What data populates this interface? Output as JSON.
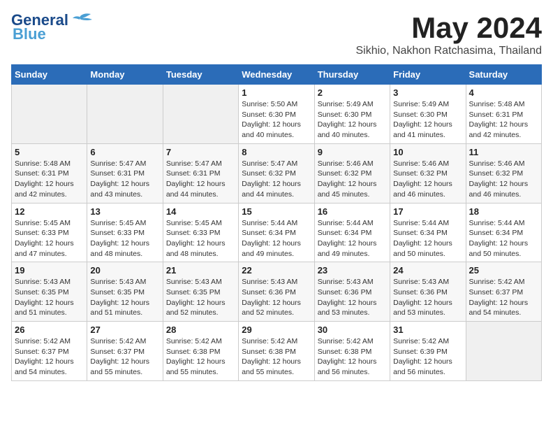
{
  "header": {
    "logo_line1": "General",
    "logo_line2": "Blue",
    "month": "May 2024",
    "location": "Sikhio, Nakhon Ratchasima, Thailand"
  },
  "weekdays": [
    "Sunday",
    "Monday",
    "Tuesday",
    "Wednesday",
    "Thursday",
    "Friday",
    "Saturday"
  ],
  "weeks": [
    [
      {
        "day": "",
        "info": ""
      },
      {
        "day": "",
        "info": ""
      },
      {
        "day": "",
        "info": ""
      },
      {
        "day": "1",
        "info": "Sunrise: 5:50 AM\nSunset: 6:30 PM\nDaylight: 12 hours\nand 40 minutes."
      },
      {
        "day": "2",
        "info": "Sunrise: 5:49 AM\nSunset: 6:30 PM\nDaylight: 12 hours\nand 40 minutes."
      },
      {
        "day": "3",
        "info": "Sunrise: 5:49 AM\nSunset: 6:30 PM\nDaylight: 12 hours\nand 41 minutes."
      },
      {
        "day": "4",
        "info": "Sunrise: 5:48 AM\nSunset: 6:31 PM\nDaylight: 12 hours\nand 42 minutes."
      }
    ],
    [
      {
        "day": "5",
        "info": "Sunrise: 5:48 AM\nSunset: 6:31 PM\nDaylight: 12 hours\nand 42 minutes."
      },
      {
        "day": "6",
        "info": "Sunrise: 5:47 AM\nSunset: 6:31 PM\nDaylight: 12 hours\nand 43 minutes."
      },
      {
        "day": "7",
        "info": "Sunrise: 5:47 AM\nSunset: 6:31 PM\nDaylight: 12 hours\nand 44 minutes."
      },
      {
        "day": "8",
        "info": "Sunrise: 5:47 AM\nSunset: 6:32 PM\nDaylight: 12 hours\nand 44 minutes."
      },
      {
        "day": "9",
        "info": "Sunrise: 5:46 AM\nSunset: 6:32 PM\nDaylight: 12 hours\nand 45 minutes."
      },
      {
        "day": "10",
        "info": "Sunrise: 5:46 AM\nSunset: 6:32 PM\nDaylight: 12 hours\nand 46 minutes."
      },
      {
        "day": "11",
        "info": "Sunrise: 5:46 AM\nSunset: 6:32 PM\nDaylight: 12 hours\nand 46 minutes."
      }
    ],
    [
      {
        "day": "12",
        "info": "Sunrise: 5:45 AM\nSunset: 6:33 PM\nDaylight: 12 hours\nand 47 minutes."
      },
      {
        "day": "13",
        "info": "Sunrise: 5:45 AM\nSunset: 6:33 PM\nDaylight: 12 hours\nand 48 minutes."
      },
      {
        "day": "14",
        "info": "Sunrise: 5:45 AM\nSunset: 6:33 PM\nDaylight: 12 hours\nand 48 minutes."
      },
      {
        "day": "15",
        "info": "Sunrise: 5:44 AM\nSunset: 6:34 PM\nDaylight: 12 hours\nand 49 minutes."
      },
      {
        "day": "16",
        "info": "Sunrise: 5:44 AM\nSunset: 6:34 PM\nDaylight: 12 hours\nand 49 minutes."
      },
      {
        "day": "17",
        "info": "Sunrise: 5:44 AM\nSunset: 6:34 PM\nDaylight: 12 hours\nand 50 minutes."
      },
      {
        "day": "18",
        "info": "Sunrise: 5:44 AM\nSunset: 6:34 PM\nDaylight: 12 hours\nand 50 minutes."
      }
    ],
    [
      {
        "day": "19",
        "info": "Sunrise: 5:43 AM\nSunset: 6:35 PM\nDaylight: 12 hours\nand 51 minutes."
      },
      {
        "day": "20",
        "info": "Sunrise: 5:43 AM\nSunset: 6:35 PM\nDaylight: 12 hours\nand 51 minutes."
      },
      {
        "day": "21",
        "info": "Sunrise: 5:43 AM\nSunset: 6:35 PM\nDaylight: 12 hours\nand 52 minutes."
      },
      {
        "day": "22",
        "info": "Sunrise: 5:43 AM\nSunset: 6:36 PM\nDaylight: 12 hours\nand 52 minutes."
      },
      {
        "day": "23",
        "info": "Sunrise: 5:43 AM\nSunset: 6:36 PM\nDaylight: 12 hours\nand 53 minutes."
      },
      {
        "day": "24",
        "info": "Sunrise: 5:43 AM\nSunset: 6:36 PM\nDaylight: 12 hours\nand 53 minutes."
      },
      {
        "day": "25",
        "info": "Sunrise: 5:42 AM\nSunset: 6:37 PM\nDaylight: 12 hours\nand 54 minutes."
      }
    ],
    [
      {
        "day": "26",
        "info": "Sunrise: 5:42 AM\nSunset: 6:37 PM\nDaylight: 12 hours\nand 54 minutes."
      },
      {
        "day": "27",
        "info": "Sunrise: 5:42 AM\nSunset: 6:37 PM\nDaylight: 12 hours\nand 55 minutes."
      },
      {
        "day": "28",
        "info": "Sunrise: 5:42 AM\nSunset: 6:38 PM\nDaylight: 12 hours\nand 55 minutes."
      },
      {
        "day": "29",
        "info": "Sunrise: 5:42 AM\nSunset: 6:38 PM\nDaylight: 12 hours\nand 55 minutes."
      },
      {
        "day": "30",
        "info": "Sunrise: 5:42 AM\nSunset: 6:38 PM\nDaylight: 12 hours\nand 56 minutes."
      },
      {
        "day": "31",
        "info": "Sunrise: 5:42 AM\nSunset: 6:39 PM\nDaylight: 12 hours\nand 56 minutes."
      },
      {
        "day": "",
        "info": ""
      }
    ]
  ]
}
